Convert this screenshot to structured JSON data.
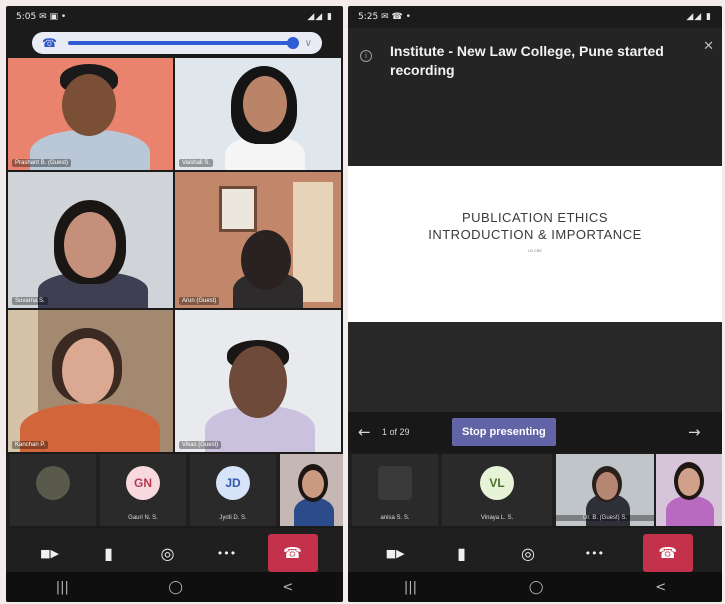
{
  "left_phone": {
    "status_time": "5:05",
    "status_icons_left": "✉ ▣ •",
    "status_icons_right": "◢◢ ▮",
    "participants": [
      {
        "name": "Prashant B. (Guest)",
        "bg": "#e9836d"
      },
      {
        "name": "Vaishali S.",
        "bg": "#dfe7ec"
      },
      {
        "name": "Suvarna S.",
        "bg": "#d0d4d8"
      },
      {
        "name": "Arun (Guest)",
        "bg": "#c2876a"
      },
      {
        "name": "Kanchan P.",
        "bg": "#a28970"
      },
      {
        "name": "Vikas (Guest)",
        "bg": "#e8eaee"
      }
    ],
    "strip": [
      {
        "initials": "",
        "name": ""
      },
      {
        "initials": "GN",
        "name": "Gauri N. S."
      },
      {
        "initials": "JD",
        "name": "Jyoti D. S."
      },
      {
        "initials": "",
        "name": ""
      }
    ]
  },
  "right_phone": {
    "status_time": "5:25",
    "status_icons_left": "✉ ☎ •",
    "status_icons_right": "◢◢ ▮",
    "banner_message": "Institute - New Law College, Pune started recording",
    "slide_title_line1": "PUBLICATION ETHICS",
    "slide_title_line2": "INTRODUCTION & IMPORTANCE",
    "slide_subtitle": "I.B.CBE",
    "page_count": "1 of 29",
    "stop_presenting_label": "Stop presenting",
    "strip": [
      {
        "initials": "",
        "name": "anisa S. S."
      },
      {
        "initials": "VL",
        "name": "Vinaya L. S."
      },
      {
        "initials": "",
        "name": "Dr. B. (Guest) S."
      },
      {
        "initials": "",
        "name": ""
      }
    ]
  },
  "icons": {
    "camera": "camera-icon",
    "mic": "microphone-icon",
    "speaker": "speaker-icon",
    "more": "more-options-icon",
    "hangup": "hang-up-icon",
    "nav_recents": "recents-icon",
    "nav_home": "home-icon",
    "nav_back": "back-icon"
  },
  "glyphs": {
    "camera": "■▶",
    "mic": "▮",
    "speaker": "◎",
    "more": "•••",
    "hangup": "☎",
    "recents": "|||",
    "home": "◯",
    "back": "<",
    "prev": "←",
    "next": "→",
    "close": "✕",
    "info": "i",
    "phone": "☎",
    "chevron": "∨"
  },
  "colors": {
    "accent": "#6264a7",
    "hangup": "#c4314b",
    "gn_avatar": "#f8d9dd",
    "jd_avatar": "#d7e3f8",
    "vl_avatar": "#e7f3d6"
  }
}
